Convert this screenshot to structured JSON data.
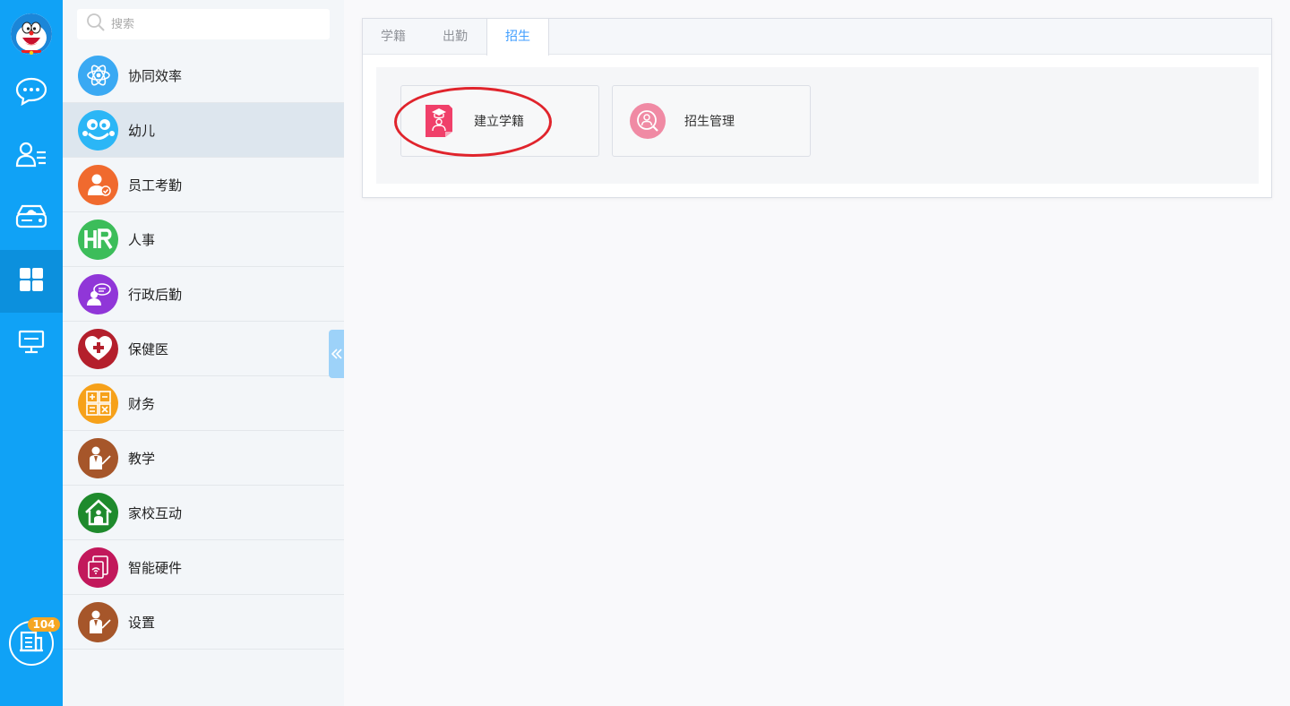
{
  "search": {
    "placeholder": "搜索"
  },
  "rail": {
    "items": [
      {
        "icon": "chat-icon"
      },
      {
        "icon": "contacts-icon"
      },
      {
        "icon": "cloud-drive-icon"
      },
      {
        "icon": "apps-grid-icon"
      },
      {
        "icon": "monitor-icon"
      }
    ],
    "badge": "104"
  },
  "sidebar": {
    "items": [
      {
        "label": "协同效率",
        "color": "#3aa9f3",
        "icon": "atom-icon"
      },
      {
        "label": "幼儿",
        "color": "#2bb6f6",
        "icon": "child-face-icon"
      },
      {
        "label": "员工考勤",
        "color": "#f06a2e",
        "icon": "employee-attendance-icon"
      },
      {
        "label": "人事",
        "color": "#3cbd5a",
        "icon": "hr-icon"
      },
      {
        "label": "行政后勤",
        "color": "#9036d8",
        "icon": "admin-logistics-icon"
      },
      {
        "label": "保健医",
        "color": "#b41f2c",
        "icon": "health-heart-icon"
      },
      {
        "label": "财务",
        "color": "#f6a11a",
        "icon": "calculator-icon"
      },
      {
        "label": "教学",
        "color": "#a6562a",
        "icon": "teacher-icon"
      },
      {
        "label": "家校互动",
        "color": "#1e8a2c",
        "icon": "home-school-icon"
      },
      {
        "label": "智能硬件",
        "color": "#c2185b",
        "icon": "smart-device-icon"
      },
      {
        "label": "设置",
        "color": "#a6562a",
        "icon": "settings-teacher-icon"
      }
    ]
  },
  "main": {
    "tabs": [
      {
        "label": "学籍"
      },
      {
        "label": "出勤"
      },
      {
        "label": "招生"
      }
    ],
    "active_tab": 2,
    "cards": [
      {
        "label": "建立学籍",
        "icon": "student-record-icon",
        "color": "#f0406a"
      },
      {
        "label": "招生管理",
        "icon": "enrollment-search-icon",
        "color": "#f08aa4"
      }
    ]
  }
}
